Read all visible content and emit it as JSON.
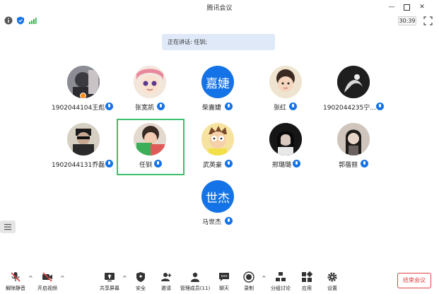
{
  "window": {
    "title": "腾讯会议"
  },
  "status": {
    "timer": "30:39"
  },
  "banner": {
    "speaking": "正在讲话: 任钏;"
  },
  "participants": [
    {
      "name": "1902044104王彪",
      "avatar_text": ""
    },
    {
      "name": "张宽凯",
      "avatar_text": ""
    },
    {
      "name": "柴嘉婕",
      "avatar_text": "嘉婕"
    },
    {
      "name": "张红",
      "avatar_text": ""
    },
    {
      "name": "1902044235宁...",
      "avatar_text": ""
    },
    {
      "name": "1902044131乔磊",
      "avatar_text": ""
    },
    {
      "name": "任钏",
      "avatar_text": ""
    },
    {
      "name": "武英豪",
      "avatar_text": ""
    },
    {
      "name": "邢璐璐",
      "avatar_text": ""
    },
    {
      "name": "郭蓓丽",
      "avatar_text": ""
    },
    {
      "name": "马世杰",
      "avatar_text": "世杰"
    }
  ],
  "toolbar": {
    "mute": "解除静音",
    "video": "开启视频",
    "share": "共享屏幕",
    "security": "安全",
    "invite": "邀请",
    "manage": "管理成员(11)",
    "chat": "聊天",
    "record": "录制",
    "breakout": "分组讨论",
    "apps": "应用",
    "settings": "设置",
    "end": "结束会议"
  },
  "colors": {
    "accent": "#1473e6",
    "active_border": "#3dbf6b",
    "end": "#e04040",
    "banner": "#dfe9f8"
  }
}
